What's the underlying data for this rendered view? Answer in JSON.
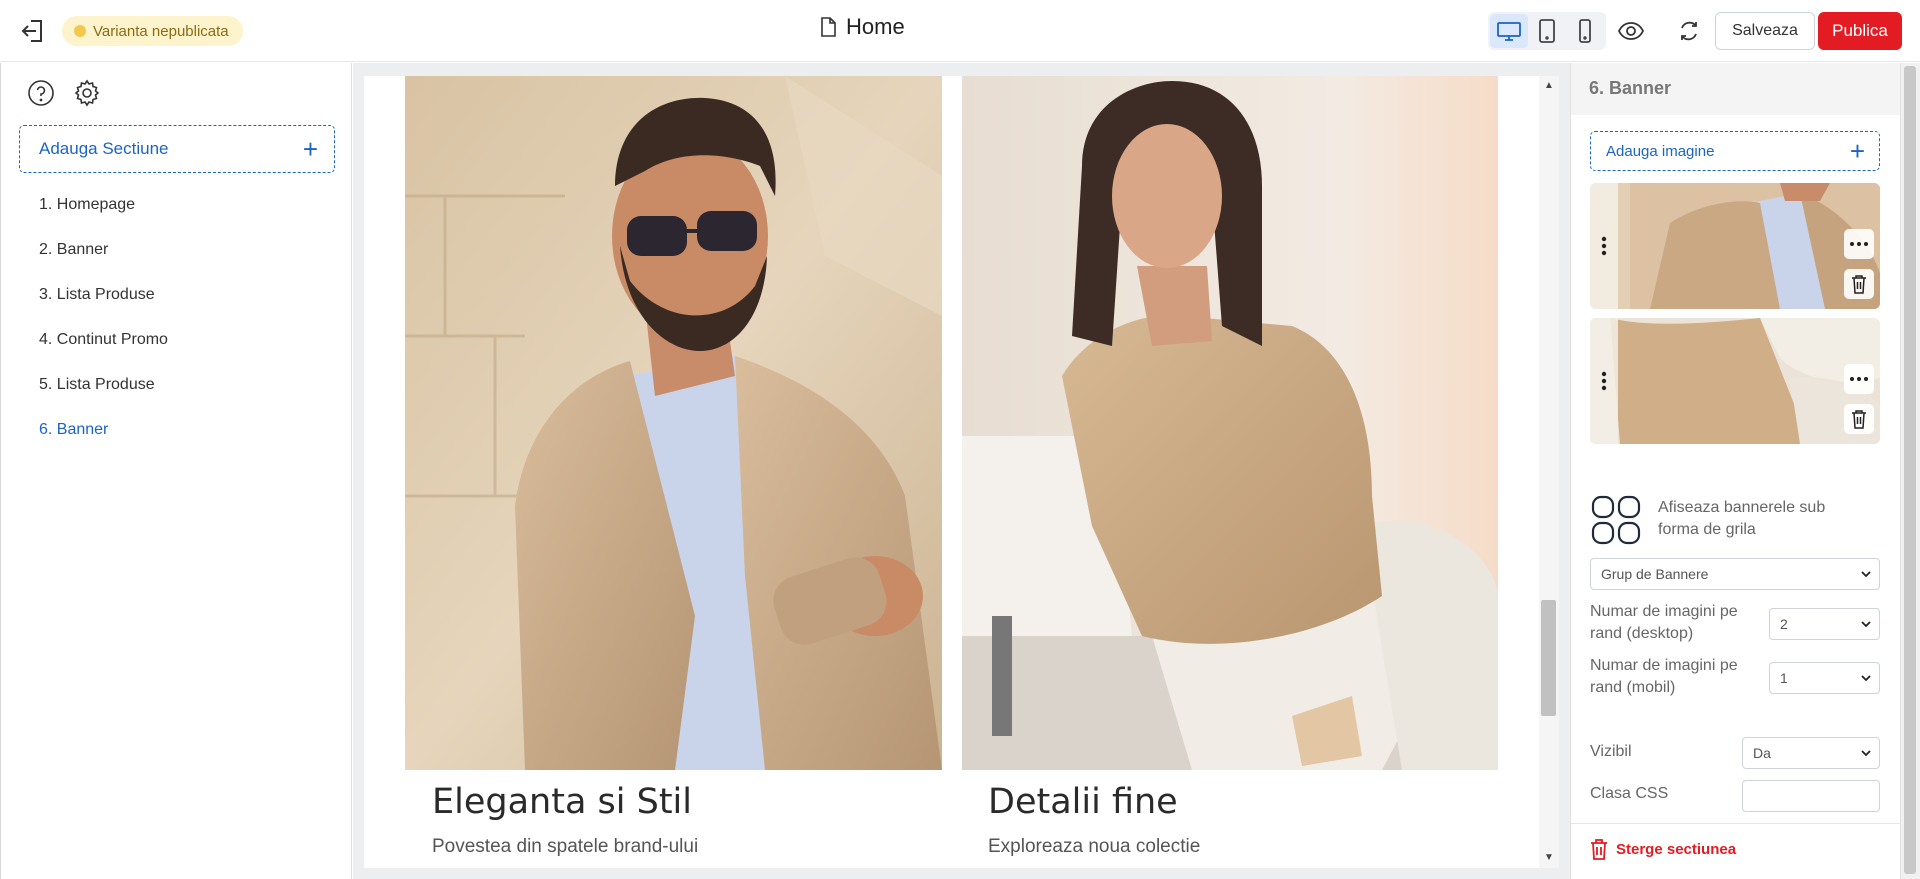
{
  "header": {
    "status_badge": "Varianta nepublicata",
    "page_title": "Home",
    "save_label": "Salveaza",
    "publish_label": "Publica",
    "active_device": "desktop"
  },
  "left_sidebar": {
    "add_section_label": "Adauga Sectiune",
    "sections": [
      {
        "label": "1. Homepage"
      },
      {
        "label": "2. Banner"
      },
      {
        "label": "3. Lista Produse"
      },
      {
        "label": "4. Continut Promo"
      },
      {
        "label": "5. Lista Produse"
      },
      {
        "label": "6. Banner"
      }
    ],
    "active_section_index": 5
  },
  "preview": {
    "banners": [
      {
        "title": "Eleganta si Stil",
        "subtitle": "Povestea din spatele brand-ului"
      },
      {
        "title": "Detalii fine",
        "subtitle": "Exploreaza noua colectie"
      }
    ]
  },
  "right_panel": {
    "section_title": "6. Banner",
    "add_image_label": "Adauga imagine",
    "grid_label": "Afiseaza bannerele sub forma de grila",
    "type_select": "Grup de Bannere",
    "desktop_label": "Numar de imagini pe rand (desktop)",
    "desktop_value": "2",
    "mobile_label": "Numar de imagini pe rand (mobil)",
    "mobile_value": "1",
    "visible_label": "Vizibil",
    "visible_value": "Da",
    "css_class_label": "Clasa CSS",
    "css_class_value": "",
    "delete_label": "Sterge sectiunea"
  },
  "colors": {
    "accent": "#1b64c4",
    "publish": "#e31b23",
    "badge_bg": "#fdf3cc"
  }
}
